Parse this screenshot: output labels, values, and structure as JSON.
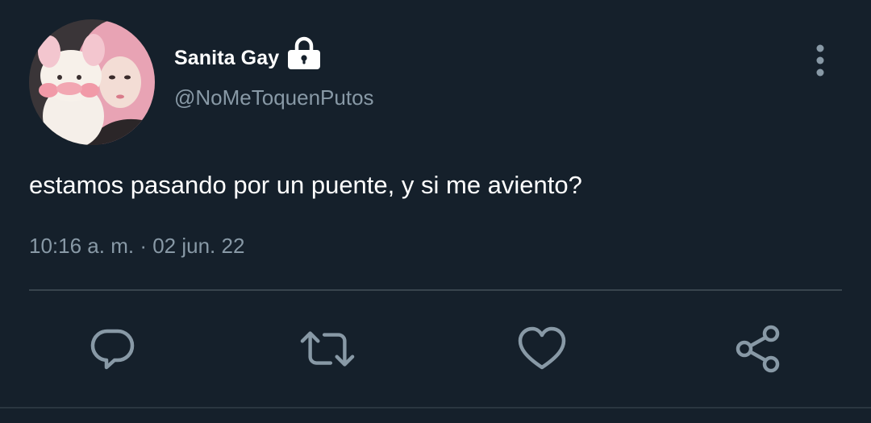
{
  "user": {
    "display_name": "Sanita Gay",
    "handle": "@NoMeToquenPutos",
    "avatar_icon": "avatar-photo",
    "protected_icon": "lock-icon"
  },
  "tweet": {
    "text": "estamos pasando por un puente, y si me aviento?",
    "time": "10:16 a. m.",
    "separator": "·",
    "date": "02 jun. 22"
  },
  "actions": {
    "reply_icon": "reply-icon",
    "retweet_icon": "retweet-icon",
    "like_icon": "heart-icon",
    "share_icon": "share-icon"
  },
  "colors": {
    "background": "#15202b",
    "text_primary": "#ffffff",
    "text_secondary": "#8899a6",
    "divider": "#38444d",
    "icon": "#8899a6"
  }
}
